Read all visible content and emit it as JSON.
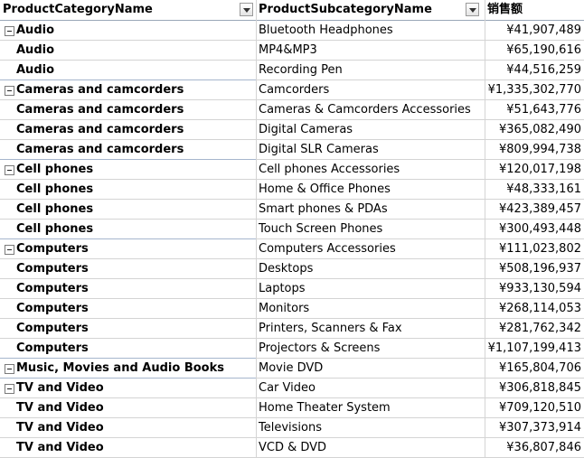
{
  "columns": [
    {
      "label": "ProductCategoryName",
      "filter_icon": "filter-dropdown-icon"
    },
    {
      "label": "ProductSubcategoryName",
      "filter_icon": "filter-dropdown-icon"
    },
    {
      "label": "销售额"
    }
  ],
  "rows": [
    {
      "category": "Audio",
      "subcategory": "Bluetooth Headphones",
      "sales": "¥41,907,489",
      "group_start": true
    },
    {
      "category": "Audio",
      "subcategory": "MP4&MP3",
      "sales": "¥65,190,616"
    },
    {
      "category": "Audio",
      "subcategory": "Recording Pen",
      "sales": "¥44,516,259"
    },
    {
      "category": "Cameras and camcorders",
      "subcategory": "Camcorders",
      "sales": "¥1,335,302,770",
      "group_start": true
    },
    {
      "category": "Cameras and camcorders",
      "subcategory": "Cameras & Camcorders Accessories",
      "sales": "¥51,643,776"
    },
    {
      "category": "Cameras and camcorders",
      "subcategory": "Digital Cameras",
      "sales": "¥365,082,490"
    },
    {
      "category": "Cameras and camcorders",
      "subcategory": "Digital SLR Cameras",
      "sales": "¥809,994,738"
    },
    {
      "category": "Cell phones",
      "subcategory": "Cell phones Accessories",
      "sales": "¥120,017,198",
      "group_start": true
    },
    {
      "category": "Cell phones",
      "subcategory": "Home & Office Phones",
      "sales": "¥48,333,161"
    },
    {
      "category": "Cell phones",
      "subcategory": "Smart phones & PDAs",
      "sales": "¥423,389,457"
    },
    {
      "category": "Cell phones",
      "subcategory": "Touch Screen Phones",
      "sales": "¥300,493,448"
    },
    {
      "category": "Computers",
      "subcategory": "Computers Accessories",
      "sales": "¥111,023,802",
      "group_start": true
    },
    {
      "category": "Computers",
      "subcategory": "Desktops",
      "sales": "¥508,196,937"
    },
    {
      "category": "Computers",
      "subcategory": "Laptops",
      "sales": "¥933,130,594"
    },
    {
      "category": "Computers",
      "subcategory": "Monitors",
      "sales": "¥268,114,053"
    },
    {
      "category": "Computers",
      "subcategory": "Printers, Scanners & Fax",
      "sales": "¥281,762,342"
    },
    {
      "category": "Computers",
      "subcategory": "Projectors & Screens",
      "sales": "¥1,107,199,413"
    },
    {
      "category": "Music, Movies and Audio Books",
      "subcategory": "Movie DVD",
      "sales": "¥165,804,706",
      "group_start": true
    },
    {
      "category": "TV and Video",
      "subcategory": "Car Video",
      "sales": "¥306,818,845",
      "group_start": true
    },
    {
      "category": "TV and Video",
      "subcategory": "Home Theater System",
      "sales": "¥709,120,510"
    },
    {
      "category": "TV and Video",
      "subcategory": "Televisions",
      "sales": "¥307,373,914"
    },
    {
      "category": "TV and Video",
      "subcategory": "VCD & DVD",
      "sales": "¥36,807,846"
    }
  ]
}
